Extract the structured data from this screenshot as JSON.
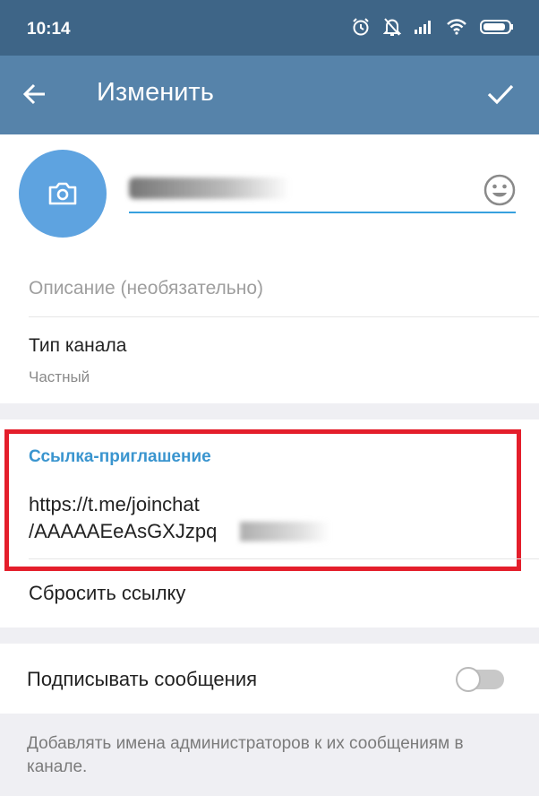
{
  "status_bar": {
    "time": "10:14",
    "icons": [
      "alarm-icon",
      "bell-off-icon",
      "signal-icon",
      "wifi-icon",
      "battery-icon"
    ]
  },
  "toolbar": {
    "title": "Изменить",
    "back_icon": "arrow-left-icon",
    "done_icon": "check-icon"
  },
  "profile": {
    "avatar_icon": "camera-icon",
    "emoji_icon": "smile-icon",
    "accent_color": "#37a1de"
  },
  "description": {
    "placeholder": "Описание (необязательно)"
  },
  "channel_type": {
    "label": "Тип канала",
    "value": "Частный"
  },
  "invite": {
    "header": "Ссылка-приглашение",
    "link_line1": "https://t.me/joinchat",
    "link_line2": "/AAAAAEeAsGXJzpq"
  },
  "reset_link": {
    "label": "Сбросить ссылку"
  },
  "sign_messages": {
    "label": "Подписывать сообщения",
    "enabled": false,
    "hint": "Добавлять имена администраторов к их сообщениям в канале."
  },
  "colors": {
    "statusbar": "#3e6587",
    "toolbar": "#5683aa",
    "highlight": "#e41e2b",
    "link_header": "#3a95cf"
  }
}
